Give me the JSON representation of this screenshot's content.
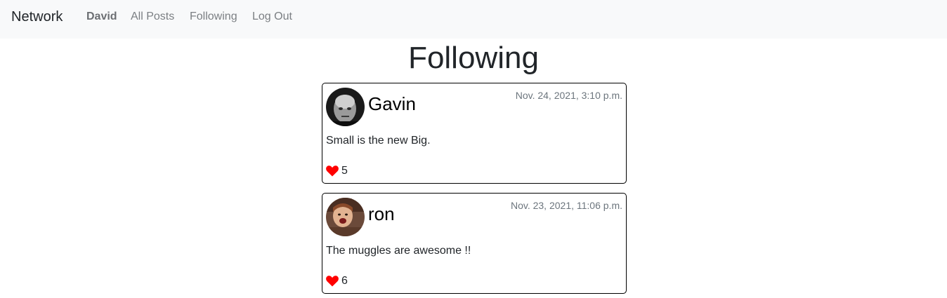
{
  "nav": {
    "brand": "Network",
    "user": "David",
    "all_posts": "All Posts",
    "following": "Following",
    "logout": "Log Out"
  },
  "page": {
    "title": "Following"
  },
  "posts": [
    {
      "username": "Gavin",
      "timestamp": "Nov. 24, 2021, 3:10 p.m.",
      "content": "Small is the new Big.",
      "likes": "5"
    },
    {
      "username": "ron",
      "timestamp": "Nov. 23, 2021, 11:06 p.m.",
      "content": "The muggles are awesome !!",
      "likes": "6"
    }
  ],
  "colors": {
    "heart": "#ff0000",
    "navbar_bg": "#f8f9fa",
    "muted_text": "#6c757d"
  },
  "icons": {
    "like": "heart-icon"
  }
}
